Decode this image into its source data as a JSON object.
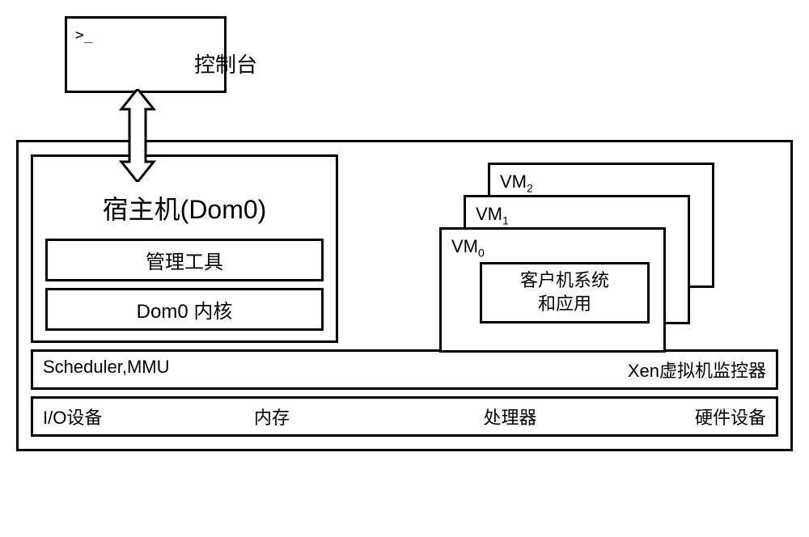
{
  "console": {
    "prompt": ">_",
    "label": "控制台"
  },
  "dom0": {
    "title": "宿主机(Dom0)",
    "mgmt_tools": "管理工具",
    "kernel": "Dom0 内核"
  },
  "vms": {
    "vm2_label": "VM",
    "vm2_sub": "2",
    "vm1_label": "VM",
    "vm1_sub": "1",
    "vm0_label": "VM",
    "vm0_sub": "0",
    "guest_line1": "客户机系统",
    "guest_line2": "和应用"
  },
  "monitor": {
    "scheduler": "Scheduler,MMU",
    "xen": "Xen虚拟机监控器"
  },
  "hardware": {
    "io": "I/O设备",
    "memory": "内存",
    "processor": "处理器",
    "hw": "硬件设备"
  }
}
